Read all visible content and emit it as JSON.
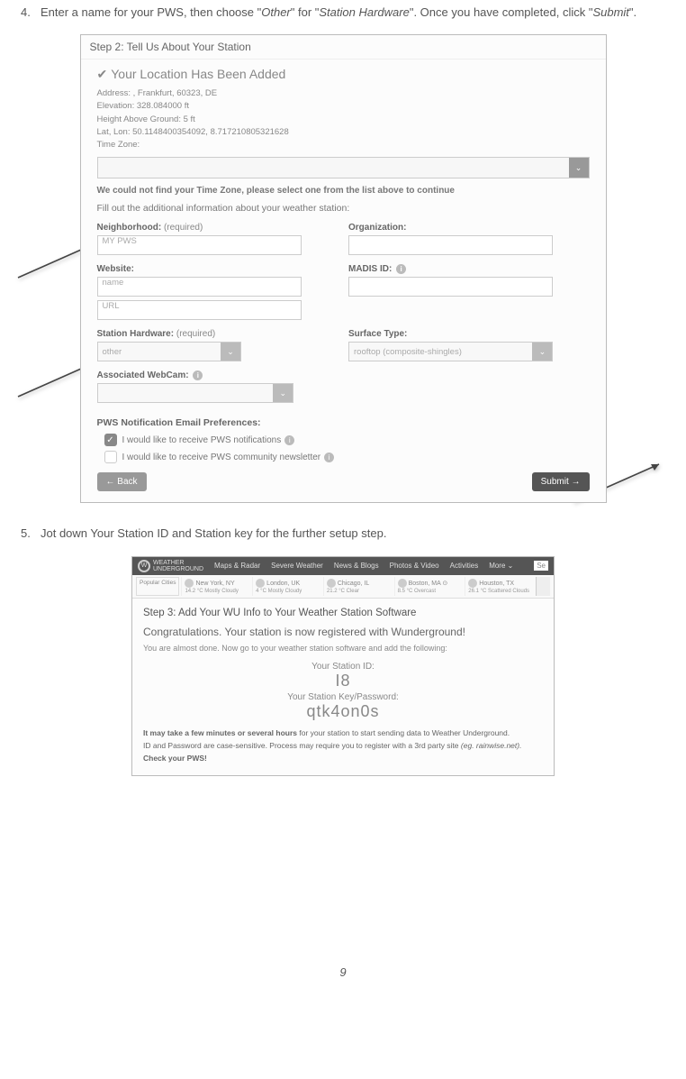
{
  "step4": {
    "num": "4.",
    "text_pre": "Enter a name for your PWS, then choose \"",
    "em1": "Other",
    "text_mid1": "\" for \"",
    "em2": "Station Hardware",
    "text_mid2": "\". Once you have completed, click \"",
    "em3": "Submit",
    "text_end": "\"."
  },
  "ss1": {
    "header": "Step 2: Tell Us About Your Station",
    "loc_title": "Your Location Has Been Added",
    "addr": {
      "l1": "Address:  , Frankfurt, 60323, DE",
      "l2": "Elevation:   328.084000   ft",
      "l3": "Height Above Ground:   5   ft",
      "l4": "Lat, Lon:   50.1148400354092, 8.717210805321628",
      "l5": "Time Zone:"
    },
    "tz_note": "We could not find your Time Zone, please select one from the list above to continue",
    "fill_note": "Fill out the additional information about your weather station:",
    "labels": {
      "neighborhood": "Neighborhood:",
      "required": "(required)",
      "organization": "Organization:",
      "website": "Website:",
      "madis": "MADIS ID:",
      "hardware": "Station Hardware:",
      "surface": "Surface Type:",
      "webcam": "Associated WebCam:"
    },
    "values": {
      "neighborhood_val": "MY PWS",
      "website_name_ph": "name",
      "website_url_ph": "URL",
      "hardware_val": "other",
      "surface_val": "rooftop (composite-shingles)"
    },
    "pref_header": "PWS Notification Email Preferences:",
    "pref1": "I would like to receive PWS notifications",
    "pref2": "I would like to receive PWS community newsletter",
    "back": "← Back",
    "submit": "Submit →"
  },
  "step5": {
    "num": "5.",
    "text": "Jot down Your Station ID and Station key for the further setup step."
  },
  "ss2": {
    "brand1": "WEATHER",
    "brand2": "UNDERGROUND",
    "nav": {
      "a": "Maps & Radar",
      "b": "Severe Weather",
      "c": "News & Blogs",
      "d": "Photos & Video",
      "e": "Activities",
      "f": "More ⌄",
      "g": "Se"
    },
    "citylabel": "Popular Cities",
    "cities": [
      {
        "n": "New York, NY",
        "w": "14.2 °C Mostly Cloudy"
      },
      {
        "n": "London, UK",
        "w": "4 °C Mostly Cloudy"
      },
      {
        "n": "Chicago, IL",
        "w": "21.2 °C Clear"
      },
      {
        "n": "Boston, MA ⊙",
        "w": "8.5 °C Overcast"
      },
      {
        "n": "Houston, TX",
        "w": "26.1 °C Scattered Clouds"
      }
    ],
    "h3": "Step 3: Add Your WU Info to Your Weather Station Software",
    "congrats": "Congratulations. Your station is now registered with Wunderground!",
    "sub": "You are almost done. Now go to your weather station software and add the following:",
    "id_lbl": "Your Station ID:",
    "id_val": "I8",
    "key_lbl": "Your Station Key/Password:",
    "key_val": "qtk4on0s",
    "fine1a": "It may take a few minutes or several hours",
    "fine1b": " for your station to start sending data to Weather Underground.",
    "fine2a": "ID and Password are case-sensitive. Process may require you to register with a 3rd party site ",
    "fine2b": "(eg. rainwise.net).",
    "fine3": "Check your PWS!"
  },
  "page_number": "9"
}
